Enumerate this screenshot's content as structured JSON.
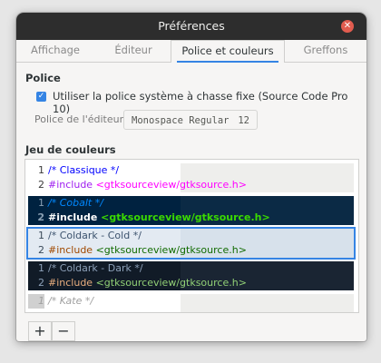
{
  "window": {
    "title": "Préférences",
    "close_glyph": "✕"
  },
  "tabs": [
    {
      "label": "Affichage"
    },
    {
      "label": "Éditeur"
    },
    {
      "label": "Police et couleurs",
      "active": true
    },
    {
      "label": "Greffons"
    }
  ],
  "font_section": {
    "title": "Police",
    "use_system_font": {
      "checked": true,
      "check_glyph": "✓",
      "label": "Utiliser la police système à chasse fixe (Source Code Pro 10)"
    },
    "editor_font": {
      "label": "Police de l'éditeur :",
      "font_name": "Monospace Regular",
      "font_size": "12"
    }
  },
  "color_section": {
    "title": "Jeu de couleurs",
    "schemes": [
      {
        "name": "classic",
        "line1_num": "1",
        "line1": "/* Classique */",
        "line2_num": "2",
        "line2_kw": "#include",
        "line2_str": "<gtksourceview/gtksource.h>",
        "colors": {
          "bg": "#ffffff",
          "right_bg": "#eeeeec",
          "num": "#3a3a3a",
          "comment": "#0000ff",
          "kw": "#a020f0",
          "str": "#ff00ff"
        }
      },
      {
        "name": "cobalt",
        "line1_num": "1",
        "line1": "/* Cobalt */",
        "line2_num": "2",
        "line2_kw": "#include",
        "line2_str": "<gtksourceview/gtksource.h>",
        "colors": {
          "bg": "#002240",
          "right_bg": "#0b2a45",
          "num": "#8aa0b4",
          "comment": "#0088ff",
          "kw": "#ffffff",
          "str": "#3ad900"
        }
      },
      {
        "name": "coldark-cold",
        "selected": true,
        "line1_num": "1",
        "line1": "/* Coldark - Cold */",
        "line2_num": "2",
        "line2_kw": "#include",
        "line2_str": "<gtksourceview/gtksource.h>",
        "colors": {
          "bg": "#e3eaf2",
          "right_bg": "#d7e1eb",
          "num": "#3a4a5a",
          "comment": "#3c526d",
          "kw": "#a04900",
          "str": "#116b00"
        }
      },
      {
        "name": "coldark-dark",
        "line1_num": "1",
        "line1": "/* Coldark - Dark */",
        "line2_num": "2",
        "line2_kw": "#include",
        "line2_str": "<gtksourceview/gtksource.h>",
        "colors": {
          "bg": "#111b27",
          "right_bg": "#1a2533",
          "num": "#8da1b9",
          "comment": "#8da1b9",
          "kw": "#e9ae7e",
          "str": "#91d076"
        }
      },
      {
        "name": "kate",
        "line1_num": "1",
        "line1": "/* Kate */",
        "colors": {
          "bg": "#ffffff",
          "right_bg": "#eeeeec",
          "num": "#a0a0a0",
          "comment": "#a0a0a0"
        }
      }
    ]
  },
  "footer": {
    "add_glyph": "+",
    "remove_glyph": "−"
  }
}
